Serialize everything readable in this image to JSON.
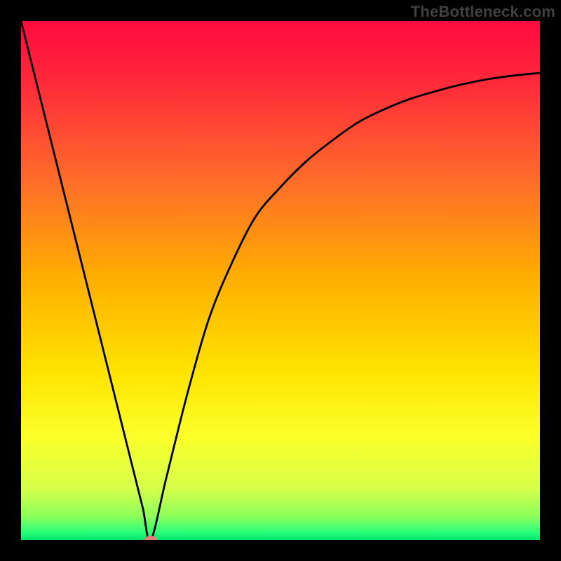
{
  "watermark": "TheBottleneck.com",
  "chart_data": {
    "type": "line",
    "title": "",
    "xlabel": "",
    "ylabel": "",
    "xlim": [
      0,
      100
    ],
    "ylim": [
      0,
      100
    ],
    "gradient_stops": [
      {
        "offset": 0.0,
        "color": "#ff0b3f"
      },
      {
        "offset": 0.12,
        "color": "#ff2a3a"
      },
      {
        "offset": 0.3,
        "color": "#ff6a2a"
      },
      {
        "offset": 0.5,
        "color": "#ffb000"
      },
      {
        "offset": 0.68,
        "color": "#ffe500"
      },
      {
        "offset": 0.8,
        "color": "#fbff2a"
      },
      {
        "offset": 0.9,
        "color": "#d7ff4a"
      },
      {
        "offset": 0.955,
        "color": "#8cff5a"
      },
      {
        "offset": 0.985,
        "color": "#2bff7a"
      },
      {
        "offset": 1.0,
        "color": "#00e56a"
      }
    ],
    "series": [
      {
        "name": "curve",
        "x": [
          0,
          5,
          10,
          15,
          19,
          22,
          23.5,
          25,
          28,
          32,
          36,
          40,
          45,
          50,
          55,
          60,
          65,
          70,
          75,
          80,
          85,
          90,
          95,
          100
        ],
        "y": [
          100,
          80,
          60,
          40,
          24,
          12,
          6,
          0,
          12,
          28,
          42,
          52,
          62,
          68,
          73,
          77,
          80.5,
          83,
          85,
          86.5,
          87.8,
          88.8,
          89.5,
          90
        ]
      }
    ],
    "marker": {
      "x": 25,
      "y": 0,
      "color": "#e77b7b",
      "rx": 9,
      "ry": 6
    }
  }
}
